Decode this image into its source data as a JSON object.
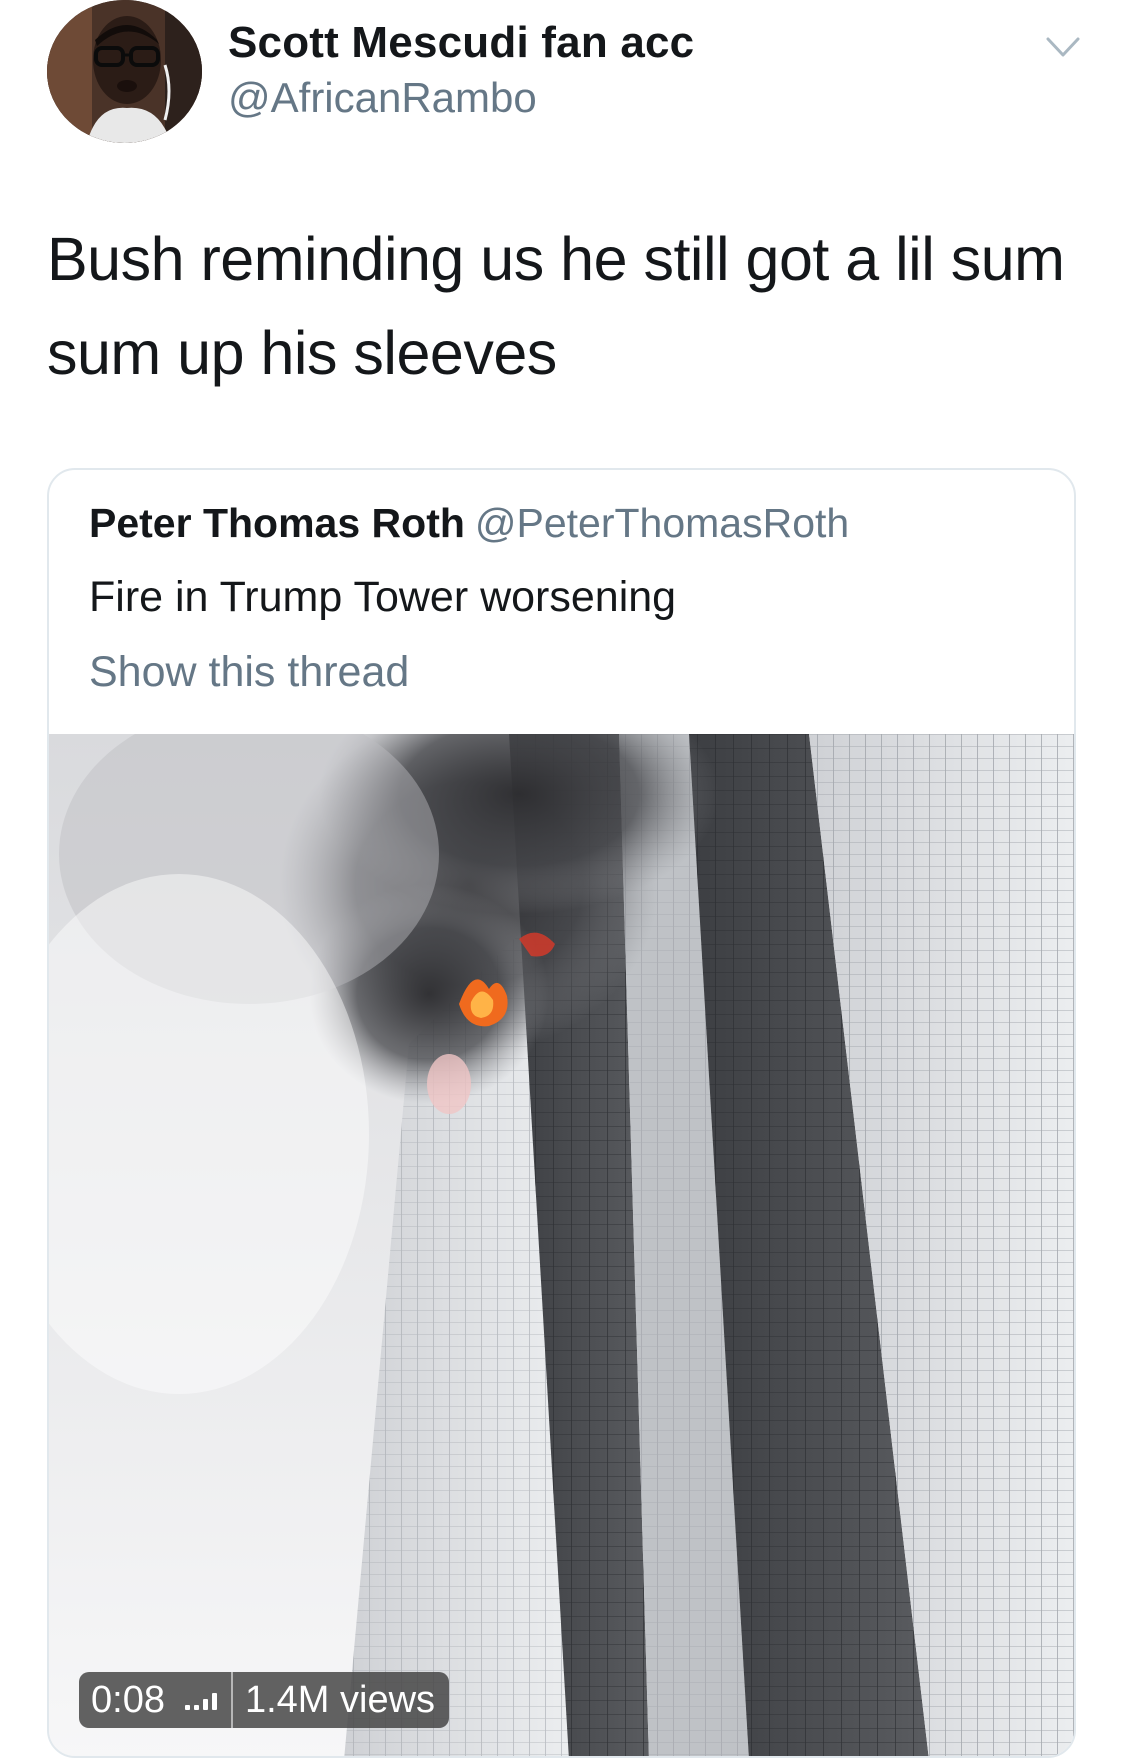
{
  "tweet": {
    "display_name": "Scott Mescudi fan acc",
    "handle": "@AfricanRambo",
    "text": "Bush reminding us he still got a lil sum sum up his sleeves",
    "avatar_icon": "profile-photo",
    "menu_icon": "chevron-down-icon"
  },
  "quoted_tweet": {
    "display_name": "Peter Thomas Roth",
    "handle": "@PeterThomasRoth",
    "text": "Fire in Trump Tower worsening",
    "show_thread": "Show this thread",
    "video": {
      "duration": "0:08",
      "views": "1.4M views",
      "status_icon": "audio-bars-icon"
    }
  },
  "colors": {
    "primary_text": "#14171a",
    "secondary_text": "#657786",
    "border": "#e1e8ed",
    "badge_bg": "#464646"
  }
}
